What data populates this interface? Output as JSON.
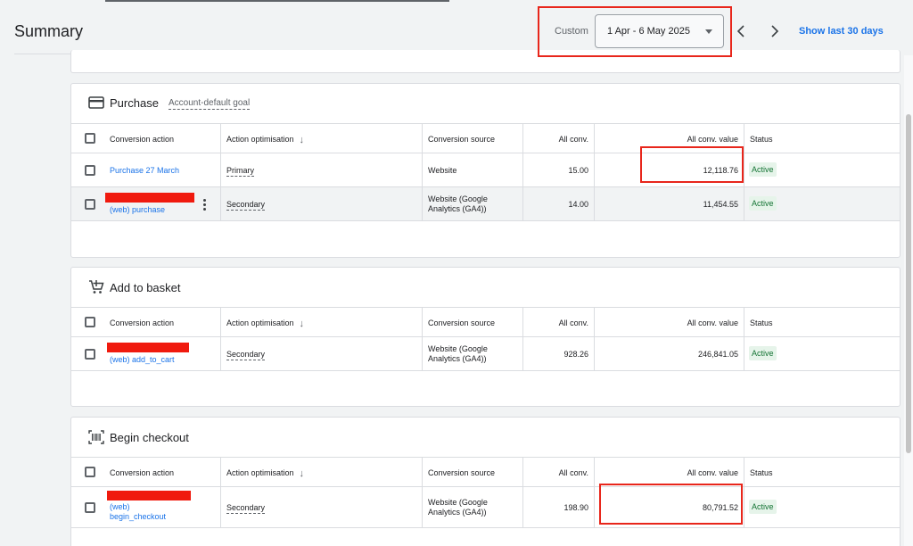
{
  "header": {
    "title": "Summary",
    "custom_label": "Custom",
    "date_range": "1 Apr - 6 May 2025",
    "show_last": "Show last 30 days"
  },
  "table_headers": {
    "conversion_action": "Conversion action",
    "action_optimisation": "Action optimisation",
    "conversion_source": "Conversion source",
    "all_conv": "All conv.",
    "all_conv_value": "All conv. value",
    "status": "Status"
  },
  "sections": [
    {
      "title": "Purchase",
      "goal": "Account-default goal",
      "icon": "credit-card-icon",
      "rows": [
        {
          "name": "Purchase 27 March",
          "optimisation": "Primary",
          "source": "Website",
          "all_conv": "15.00",
          "all_conv_value": "12,118.76",
          "status": "Active"
        },
        {
          "name": "(web) purchase",
          "optimisation": "Secondary",
          "source_line1": "Website (Google",
          "source_line2": "Analytics (GA4))",
          "all_conv": "14.00",
          "all_conv_value": "11,454.55",
          "status": "Active"
        }
      ]
    },
    {
      "title": "Add to basket",
      "icon": "add-to-cart-icon",
      "rows": [
        {
          "name": "(web) add_to_cart",
          "optimisation": "Secondary",
          "source_line1": "Website (Google",
          "source_line2": "Analytics (GA4))",
          "all_conv": "928.26",
          "all_conv_value": "246,841.05",
          "status": "Active"
        }
      ]
    },
    {
      "title": "Begin checkout",
      "icon": "barcode-scan-icon",
      "rows": [
        {
          "name_line1": "(web)",
          "name_line2": "begin_checkout",
          "optimisation": "Secondary",
          "source_line1": "Website (Google",
          "source_line2": "Analytics (GA4))",
          "all_conv": "198.90",
          "all_conv_value": "80,791.52",
          "status": "Active"
        }
      ]
    }
  ],
  "colors": {
    "accent": "#1a73e8",
    "highlight": "#e8261b",
    "redaction": "#f01a0e",
    "status_active": "#137333",
    "status_active_bg": "#e6f4ea"
  }
}
